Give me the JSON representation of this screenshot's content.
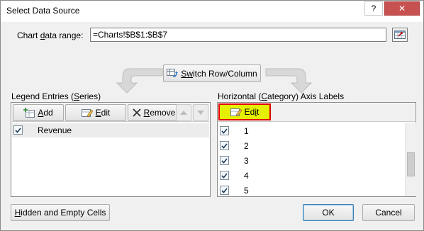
{
  "window": {
    "title": "Select Data Source",
    "help": "?",
    "close": "✕"
  },
  "range": {
    "label_pre": "Chart ",
    "label_ul": "d",
    "label_post": "ata range:",
    "value": "=Charts!$B$1:$B$7"
  },
  "switch_btn": {
    "pre": "S",
    "ul": "w",
    "post": "itch Row/Column"
  },
  "legend": {
    "heading_pre": "Legend Entries (",
    "heading_ul": "S",
    "heading_post": "eries)",
    "add": {
      "ul": "A",
      "post": "dd"
    },
    "edit": {
      "ul": "E",
      "post": "dit"
    },
    "remove": {
      "ul": "R",
      "post": "emove"
    },
    "items": [
      {
        "label": "Revenue",
        "checked": true
      }
    ]
  },
  "axis": {
    "heading_pre": "Horizontal (",
    "heading_ul": "C",
    "heading_post": "ategory) Axis Labels",
    "edit": {
      "pre": "Ed",
      "ul": "i",
      "post": "t"
    },
    "items": [
      {
        "label": "1",
        "checked": true
      },
      {
        "label": "2",
        "checked": true
      },
      {
        "label": "3",
        "checked": true
      },
      {
        "label": "4",
        "checked": true
      },
      {
        "label": "5",
        "checked": true
      }
    ]
  },
  "footer": {
    "hidden": {
      "ul": "H",
      "post": "idden and Empty Cells"
    },
    "ok": "OK",
    "cancel": "Cancel"
  },
  "colors": {
    "highlight_border": "#e00000",
    "highlight_fill": "#e5f000",
    "close_bg": "#c75050"
  }
}
